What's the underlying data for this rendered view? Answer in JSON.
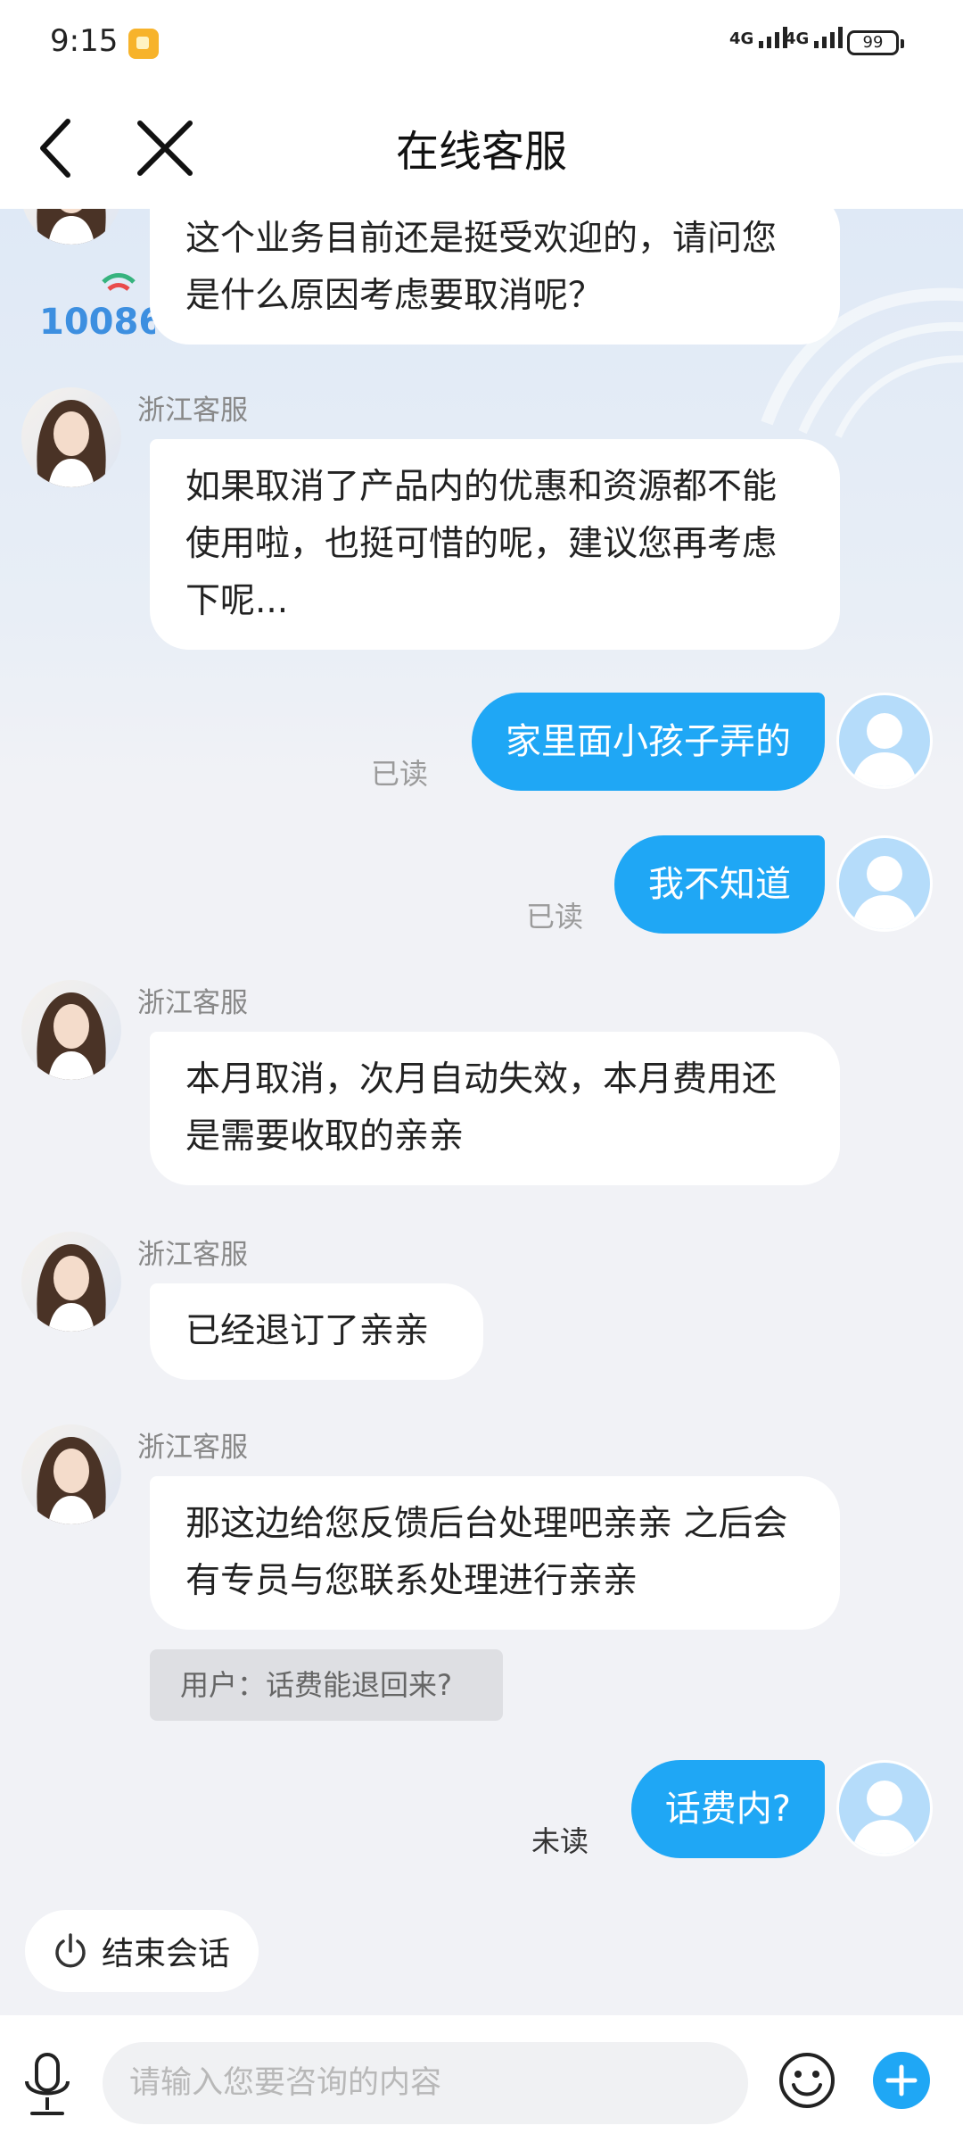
{
  "status_bar": {
    "time": "9:15",
    "network_1": "4G",
    "network_2": "4G",
    "battery": "99"
  },
  "nav": {
    "title": "在线客服"
  },
  "messages": [
    {
      "from": "agent",
      "text": "这个业务目前还是挺受欢迎的，请问您是什么原因考虑要取消呢？"
    },
    {
      "from": "agent",
      "sender": "浙江客服",
      "text": "如果取消了产品内的优惠和资源都不能使用啦，也挺可惜的呢，建议您再考虑下呢..."
    },
    {
      "from": "user",
      "text": "家里面小孩子弄的",
      "status": "已读"
    },
    {
      "from": "user",
      "text": "我不知道",
      "status": "已读"
    },
    {
      "from": "agent",
      "sender": "浙江客服",
      "text": "本月取消，次月自动失效，本月费用还是需要收取的亲亲"
    },
    {
      "from": "agent",
      "sender": "浙江客服",
      "text": "已经退订了亲亲"
    },
    {
      "from": "agent",
      "sender": "浙江客服",
      "text": "那这边给您反馈后台处理吧亲亲 之后会有专员与您联系处理进行亲亲"
    },
    {
      "from": "user",
      "text": "话费内?",
      "status": "未读"
    }
  ],
  "suggestion": "用户：话费能退回来?",
  "brand_logo_text": "10086",
  "end_session_label": "结束会话",
  "input": {
    "placeholder": "请输入您要咨询的内容"
  },
  "icons": [
    "back-icon",
    "close-icon",
    "power-icon",
    "microphone-icon",
    "emoji-icon",
    "plus-icon"
  ],
  "colors": {
    "accent": "#1fa7f5",
    "bubble_agent": "#ffffff",
    "chat_background": "#f1f2f6"
  }
}
